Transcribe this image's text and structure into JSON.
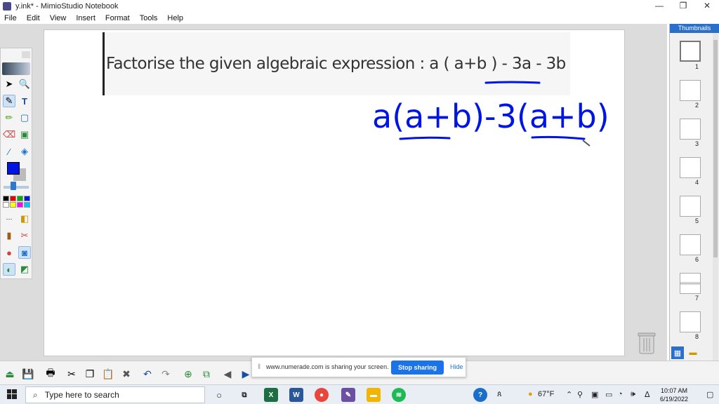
{
  "window": {
    "title": "y.ink* - MimioStudio Notebook",
    "minimize": "—",
    "restore": "❐",
    "close": "✕"
  },
  "menu": [
    "File",
    "Edit",
    "View",
    "Insert",
    "Format",
    "Tools",
    "Help"
  ],
  "question": {
    "text": "Factorise the given algebraic expression : a ( a+b ) - 3a - 3b"
  },
  "handwriting": {
    "expression": "a(a+b)-3(a+b)",
    "ink_color": "#0014e6"
  },
  "toolbox": {
    "current_color": "#0014e6",
    "palette": [
      "#000000",
      "#e60000",
      "#00b000",
      "#0014e6",
      "#ffffff",
      "#ffff00",
      "#ff00ff",
      "#00c8ff"
    ]
  },
  "thumbnails": {
    "header": "Thumbnails",
    "pages": [
      "1",
      "2",
      "3",
      "4",
      "5",
      "6",
      "7",
      "8"
    ],
    "selected": "1"
  },
  "sharing": {
    "message": "www.numerade.com is sharing your screen.",
    "stop_label": "Stop sharing",
    "hide_label": "Hide"
  },
  "taskbar": {
    "search_placeholder": "Type here to search",
    "weather": "67°F",
    "time": "10:07 AM",
    "date": "6/19/2022"
  }
}
